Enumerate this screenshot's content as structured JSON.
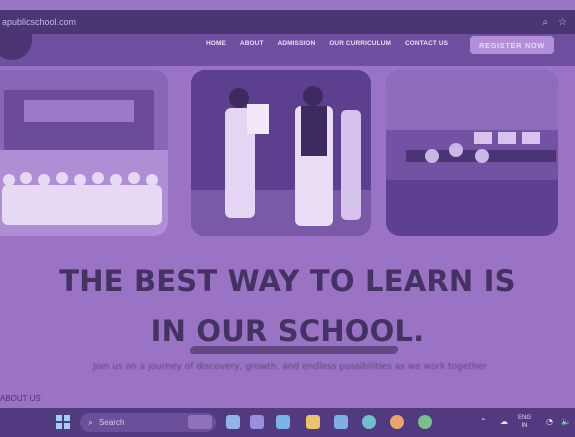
{
  "browser": {
    "url": "apublicschool.com",
    "icons": [
      "zoom-icon",
      "star-icon"
    ]
  },
  "nav": {
    "items": [
      "HOME",
      "ABOUT",
      "ADMISSION",
      "OUR CURRICULUM",
      "CONTACT US"
    ],
    "register": "REGISTER NOW"
  },
  "hero": {
    "line1": "THE BEST WAY TO LEARN IS",
    "line2": "IN OUR SCHOOL.",
    "subtext": "Join us on a journey of discovery, growth, and endless possibilities as we work together"
  },
  "section": {
    "about": "ABOUT US"
  },
  "taskbar": {
    "search": "Search",
    "lang_top": "ENG",
    "lang_bottom": "IN"
  }
}
